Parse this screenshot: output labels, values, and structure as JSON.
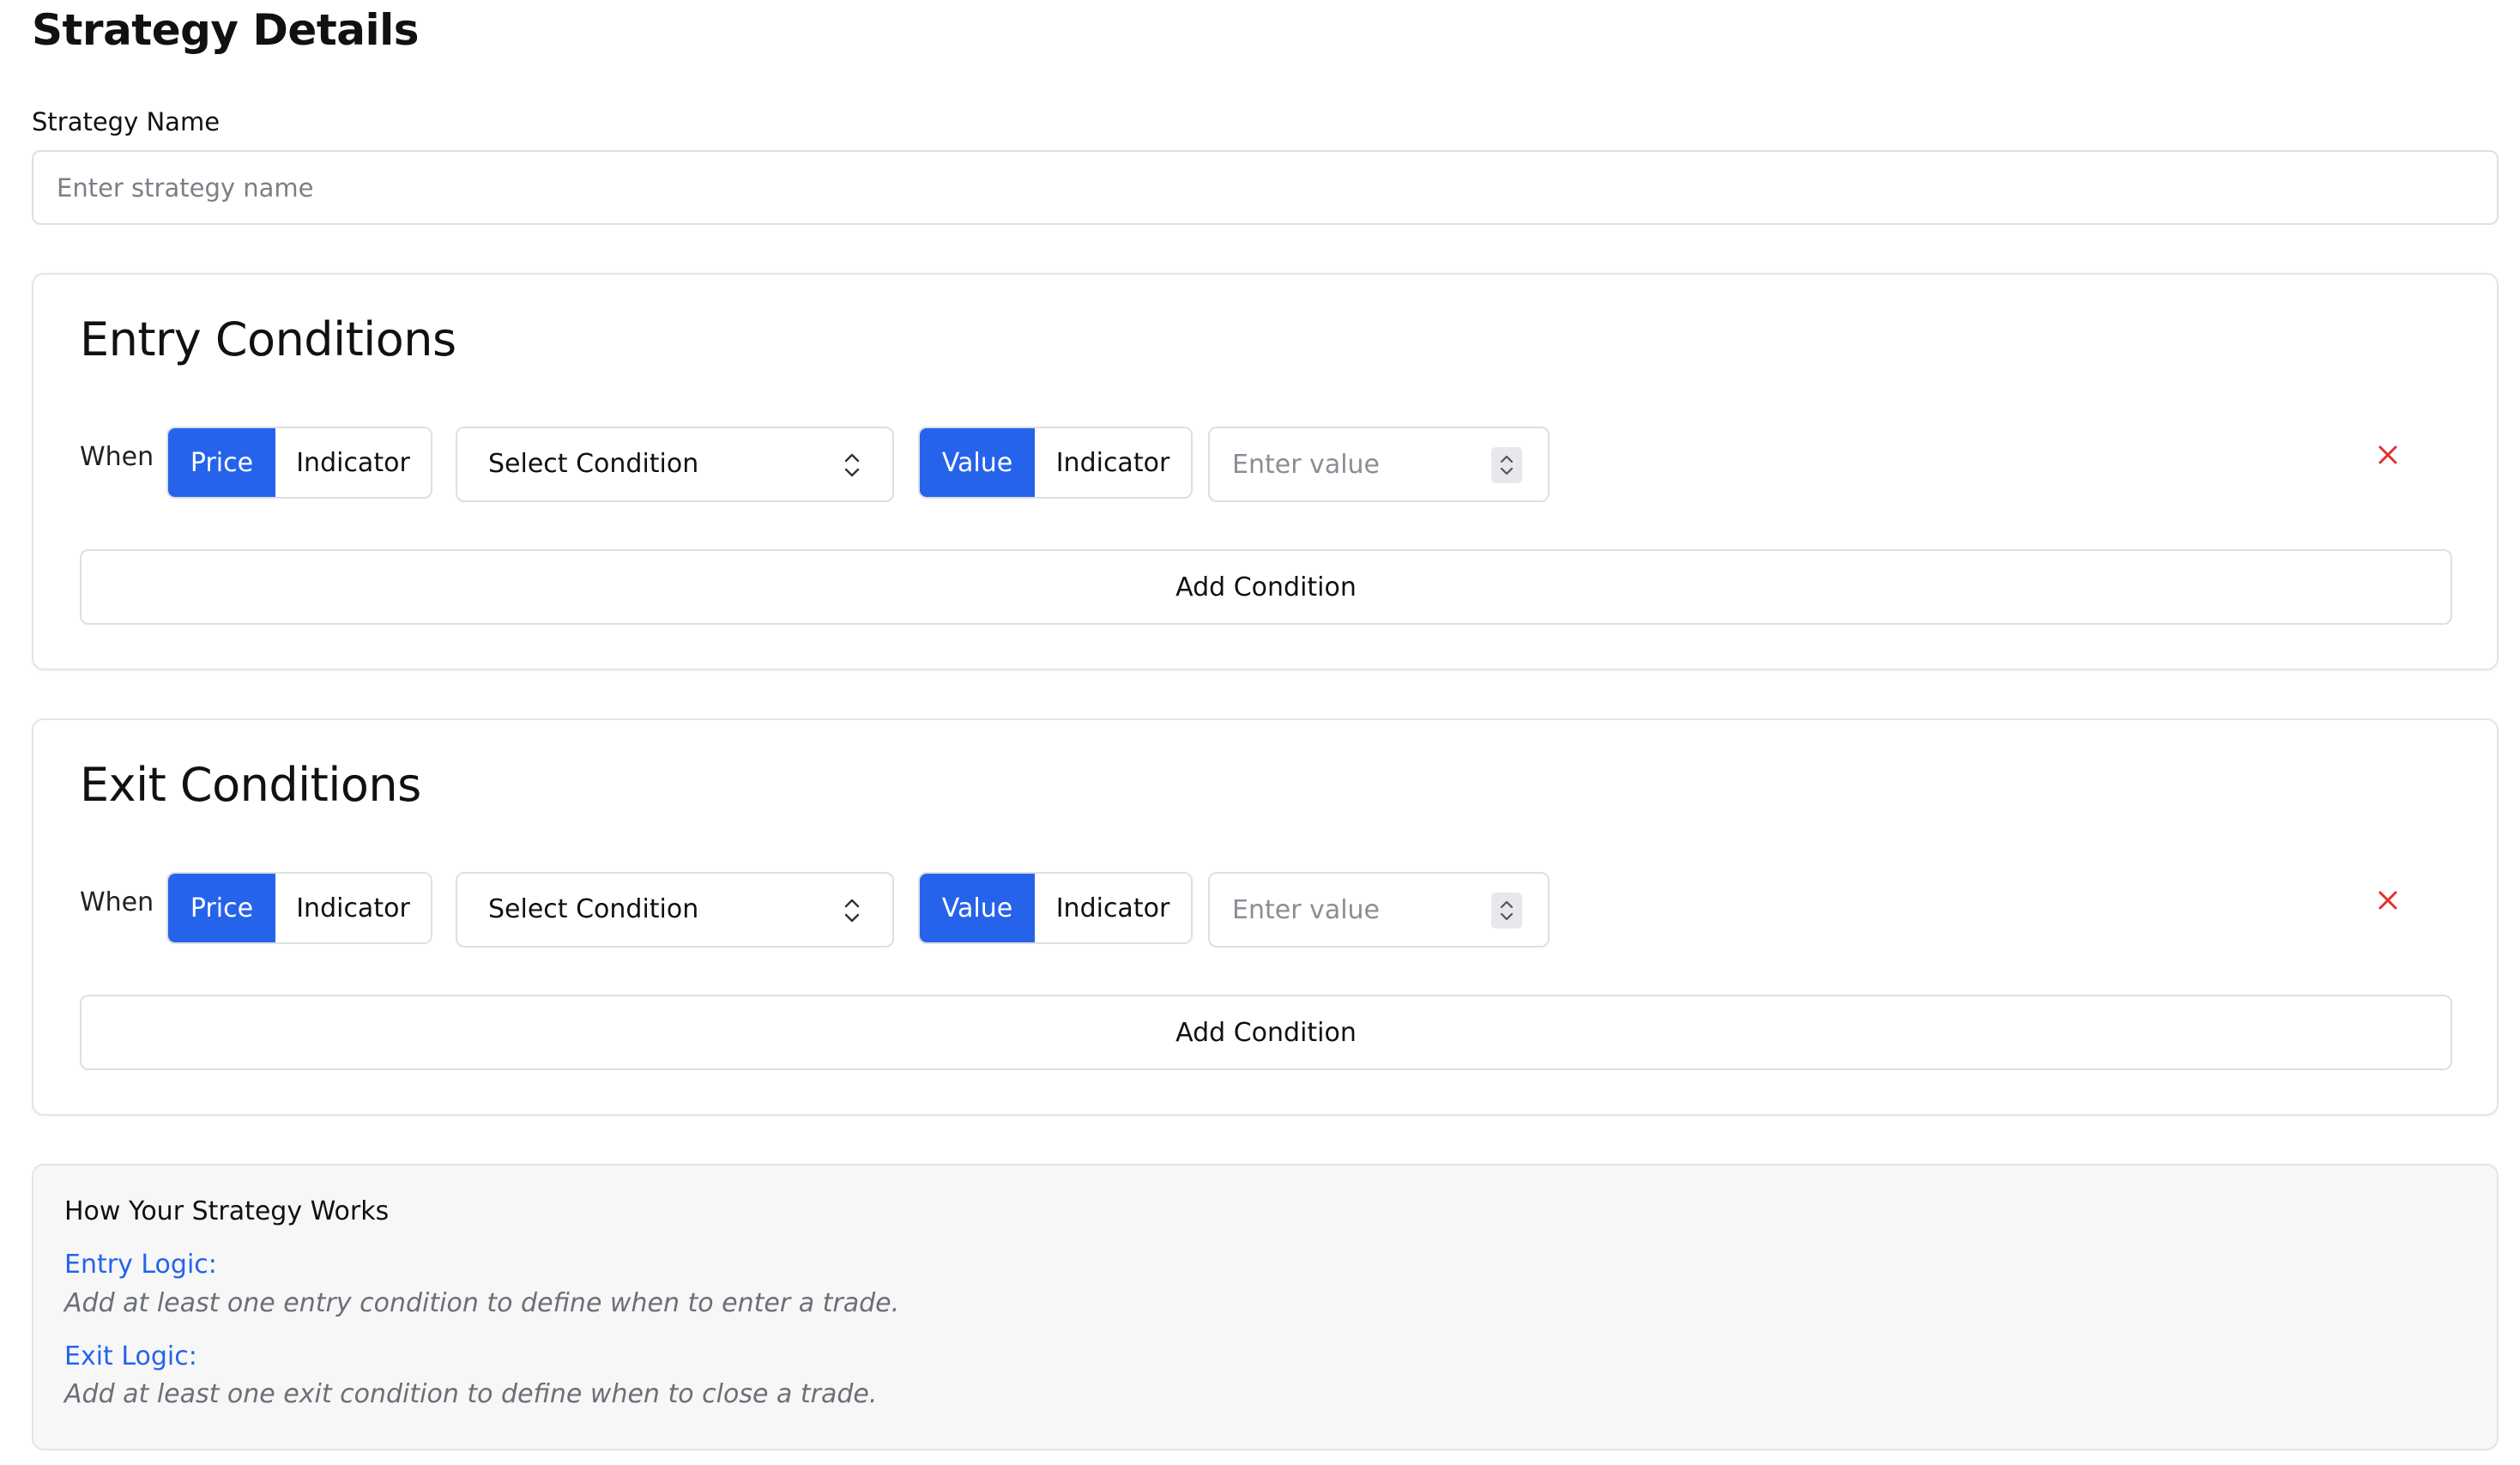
{
  "page": {
    "title": "Strategy Details"
  },
  "strategy_name": {
    "label": "Strategy Name",
    "placeholder": "Enter strategy name",
    "value": ""
  },
  "entry": {
    "title": "Entry Conditions",
    "row": {
      "when_label": "When",
      "subject_options": [
        "Price",
        "Indicator"
      ],
      "subject_selected": "Price",
      "condition_select": "Select Condition",
      "target_options": [
        "Value",
        "Indicator"
      ],
      "target_selected": "Value",
      "value_placeholder": "Enter value"
    },
    "add_label": "Add Condition"
  },
  "exit": {
    "title": "Exit Conditions",
    "row": {
      "when_label": "When",
      "subject_options": [
        "Price",
        "Indicator"
      ],
      "subject_selected": "Price",
      "condition_select": "Select Condition",
      "target_options": [
        "Value",
        "Indicator"
      ],
      "target_selected": "Value",
      "value_placeholder": "Enter value"
    },
    "add_label": "Add Condition"
  },
  "help": {
    "title": "How Your Strategy Works",
    "entry_head": "Entry Logic:",
    "entry_text": "Add at least one entry condition to define when to enter a trade.",
    "exit_head": "Exit Logic:",
    "exit_text": "Add at least one exit condition to define when to close a trade."
  },
  "icons": {
    "select_chevron": "chevron-up-down-icon",
    "spinner": "number-spinner-icon",
    "remove": "close-x-icon"
  },
  "colors": {
    "accent": "#2563eb",
    "remove": "#e03131",
    "border": "#dcdfe4",
    "help_bg": "#f7f7f8"
  }
}
